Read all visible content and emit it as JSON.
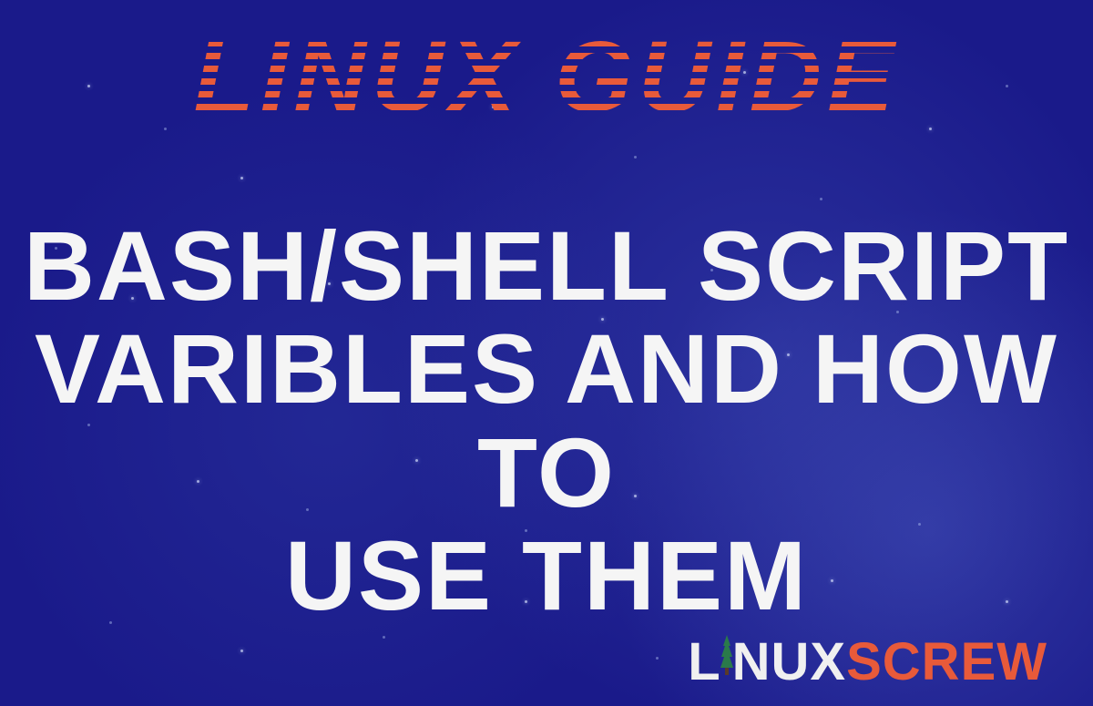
{
  "header": {
    "title": "LINUX GUIDE"
  },
  "main": {
    "title_line1": "BASH/SHELL SCRIPT",
    "title_line2": "VARIBLES AND HOW TO",
    "title_line3": "USE THEM"
  },
  "footer": {
    "logo_part1": "L",
    "logo_part2": "NUX",
    "logo_part3": "SCREW"
  },
  "colors": {
    "background": "#1a1a8a",
    "accent": "#e85a3a",
    "text": "#f5f5f5"
  }
}
